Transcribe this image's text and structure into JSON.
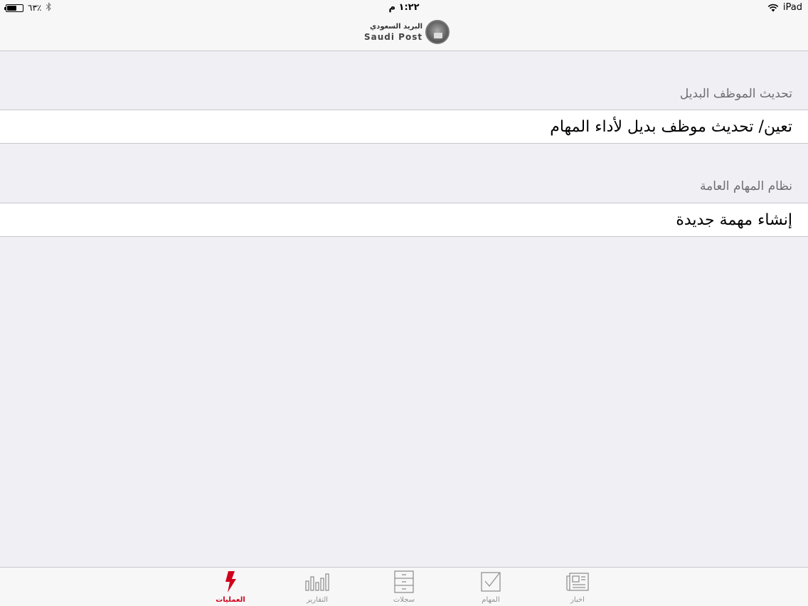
{
  "statusbar": {
    "battery_percent": "٦٣٪",
    "battery_level": 0.63,
    "time": "١:٢٢ م",
    "device": "iPad",
    "icons": [
      "battery-icon",
      "bluetooth-icon",
      "wifi-icon"
    ]
  },
  "navbar": {
    "logo_arabic": "البريد السعودي",
    "logo_english": "Saudi Post"
  },
  "sections": [
    {
      "header": "تحديث الموظف البديل",
      "items": [
        {
          "label": "تعين/ تحديث موظف بديل لأداء المهام"
        }
      ]
    },
    {
      "header": "نظام المهام العامة",
      "items": [
        {
          "label": "إنشاء مهمة جديدة"
        }
      ]
    }
  ],
  "tabbar": {
    "active_color": "#d0021b",
    "inactive_color": "#929292",
    "tabs": [
      {
        "label": "العمليات",
        "icon": "lightning-icon",
        "active": true
      },
      {
        "label": "التقارير",
        "icon": "bar-chart-icon",
        "active": false
      },
      {
        "label": "سجلات",
        "icon": "cabinet-icon",
        "active": false
      },
      {
        "label": "المهام",
        "icon": "checkbox-icon",
        "active": false
      },
      {
        "label": "اخبار",
        "icon": "newspaper-icon",
        "active": false
      }
    ]
  }
}
